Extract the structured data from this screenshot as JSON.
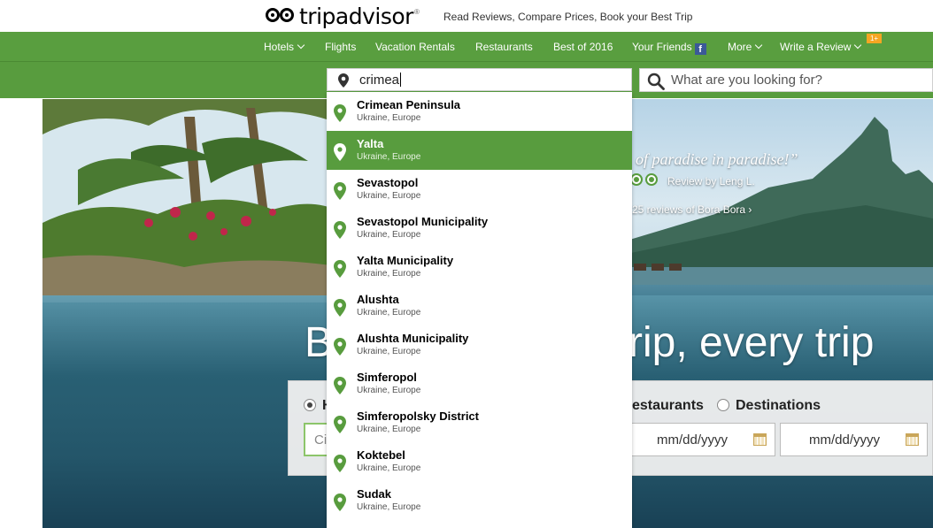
{
  "header": {
    "logo_text": "tripadvisor",
    "logo_reg": "®",
    "tagline": "Read Reviews, Compare Prices, Book your Best Trip"
  },
  "nav": {
    "items": [
      "Hotels",
      "Flights",
      "Vacation Rentals",
      "Restaurants",
      "Best of 2016",
      "Your Friends",
      "More",
      "Write a Review"
    ],
    "facebook_glyph": "f",
    "badge": "1+"
  },
  "search": {
    "where_value": "crimea",
    "what_placeholder": "What are you looking for?"
  },
  "hero": {
    "quote": "of paradise in paradise!”",
    "review_by": "Review by Leng L.",
    "reviews_link": "25 reviews of Bora Bora ›",
    "headline_left": "B",
    "headline_right": "rip, every trip",
    "bubble_rating_visible": 2
  },
  "search_panel": {
    "radio_hotels_label": "H",
    "radio_restaurants_label": "estaurants",
    "radio_destinations_label": "Destinations",
    "city_field_partial": "Ci",
    "checkin_placeholder": "mm/dd/yyyy",
    "checkout_placeholder": "mm/dd/yyyy"
  },
  "suggestions": [
    {
      "name": "Crimean Peninsula",
      "sub": "Ukraine, Europe",
      "selected": false
    },
    {
      "name": "Yalta",
      "sub": "Ukraine, Europe",
      "selected": true
    },
    {
      "name": "Sevastopol",
      "sub": "Ukraine, Europe",
      "selected": false
    },
    {
      "name": "Sevastopol Municipality",
      "sub": "Ukraine, Europe",
      "selected": false
    },
    {
      "name": "Yalta Municipality",
      "sub": "Ukraine, Europe",
      "selected": false
    },
    {
      "name": "Alushta",
      "sub": "Ukraine, Europe",
      "selected": false
    },
    {
      "name": "Alushta Municipality",
      "sub": "Ukraine, Europe",
      "selected": false
    },
    {
      "name": "Simferopol",
      "sub": "Ukraine, Europe",
      "selected": false
    },
    {
      "name": "Simferopolsky District",
      "sub": "Ukraine, Europe",
      "selected": false
    },
    {
      "name": "Koktebel",
      "sub": "Ukraine, Europe",
      "selected": false
    },
    {
      "name": "Sudak",
      "sub": "Ukraine, Europe",
      "selected": false
    }
  ],
  "colors": {
    "brand_green": "#589c3e",
    "nav_green": "#599e3f",
    "pin_green": "#589c3e"
  }
}
